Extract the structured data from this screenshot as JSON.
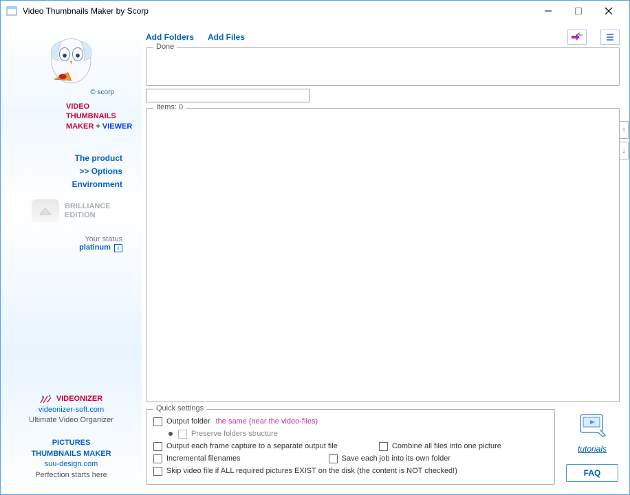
{
  "window": {
    "title": "Video Thumbnails Maker by Scorp"
  },
  "sidebar": {
    "copyright": "© scorp",
    "product_line1": "VIDEO",
    "product_line2": "THUMBNAILS",
    "product_line3a": "MAKER",
    "product_line3plus": " + ",
    "product_line3b": "VIEWER",
    "nav": {
      "product": "The product",
      "options": ">> Options",
      "environment": "Environment"
    },
    "edition_line1": "BRILLIANCE",
    "edition_line2": "EDITION",
    "status_label": "Your status",
    "status_value": "platinum",
    "status_info_glyph": "i",
    "videonizer": {
      "title": "VIDEONIZER",
      "link": "videonizer-soft.com",
      "sub": "Ultimate Video Organizer"
    },
    "pictures": {
      "title1": "PICTURES",
      "title2": "THUMBNAILS MAKER",
      "link": "suu-design.com",
      "sub": "Perfection starts here"
    }
  },
  "main": {
    "add_folders": "Add Folders",
    "add_files": "Add Files",
    "done_label": "Done",
    "done_input_value": "",
    "items_label": "Items: 0",
    "up_glyph": "↑",
    "down_glyph": "↓"
  },
  "quick": {
    "label": "Quick settings",
    "output_folder": "Output folder",
    "output_folder_link": "the same (near the video-files)",
    "preserve": "Preserve folders structure",
    "separate": "Output each frame capture to a separate output file",
    "combine": "Combine all files into one picture",
    "incremental": "Incremental filenames",
    "save_each": "Save each job into its own folder",
    "skip": "Skip video file if ALL required pictures EXIST on the disk (the content is NOT checked!)"
  },
  "right": {
    "tutorials": "tutorials",
    "faq": "FAQ"
  }
}
